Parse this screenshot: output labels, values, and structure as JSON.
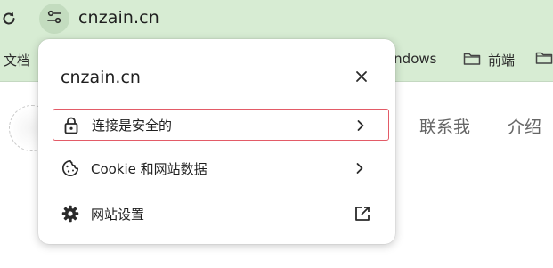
{
  "browser": {
    "url": "cnzain.cn",
    "icons": {
      "reload": "reload-icon",
      "site_info": "tune-icon"
    }
  },
  "bookmarks": {
    "docs": "文档",
    "windows_partial": "indows",
    "frontend": "前端"
  },
  "page": {
    "nav_contact": "联系我",
    "nav_about": "介绍"
  },
  "popup": {
    "title": "cnzain.cn",
    "items": [
      {
        "label": "连接是安全的",
        "icon": "lock-icon",
        "trail": "chevron-right-icon"
      },
      {
        "label": "Cookie 和网站数据",
        "icon": "cookie-icon",
        "trail": "chevron-right-icon"
      },
      {
        "label": "网站设置",
        "icon": "gear-icon",
        "trail": "open-external-icon"
      }
    ],
    "highlight_color": "#e35b67"
  },
  "colors": {
    "chrome_bg": "#d7ecd3",
    "site_info_bg": "#c3dcbf"
  }
}
